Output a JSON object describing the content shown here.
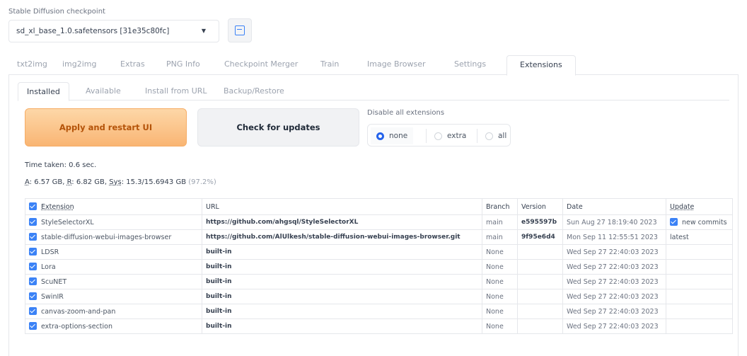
{
  "checkpoint": {
    "label": "Stable Diffusion checkpoint",
    "value": "sd_xl_base_1.0.safetensors [31e35c80fc]"
  },
  "main_tabs": [
    "txt2img",
    "img2img",
    "Extras",
    "PNG Info",
    "Checkpoint Merger",
    "Train",
    "Image Browser",
    "Settings",
    "Extensions"
  ],
  "sub_tabs": [
    "Installed",
    "Available",
    "Install from URL",
    "Backup/Restore"
  ],
  "buttons": {
    "apply": "Apply and restart UI",
    "check": "Check for updates"
  },
  "disable": {
    "label": "Disable all extensions",
    "options": [
      "none",
      "extra",
      "all"
    ],
    "selected": "none"
  },
  "time_taken": "Time taken: 0.6 sec.",
  "memory": {
    "a_label": "A",
    "a_value": ": 6.57 GB, ",
    "r_label": "R",
    "r_value": ": 6.82 GB, ",
    "sys_label": "Sys",
    "sys_value": ": 15.3/15.6943 GB ",
    "pct": "(97.2%)"
  },
  "table": {
    "headers": [
      "Extension",
      "URL",
      "Branch",
      "Version",
      "Date",
      "Update"
    ],
    "rows": [
      {
        "name": "StyleSelectorXL",
        "url": "https://github.com/ahgsql/StyleSelectorXL",
        "branch": "main",
        "version": "e595597b",
        "date": "Sun Aug 27 18:19:40 2023",
        "update": "new commits"
      },
      {
        "name": "stable-diffusion-webui-images-browser",
        "url": "https://github.com/AlUlkesh/stable-diffusion-webui-images-browser.git",
        "branch": "main",
        "version": "9f95e6d4",
        "date": "Mon Sep 11 12:55:51 2023",
        "update": "latest"
      },
      {
        "name": "LDSR",
        "url": "built-in",
        "branch": "None",
        "version": "",
        "date": "Wed Sep 27 22:40:03 2023",
        "update": ""
      },
      {
        "name": "Lora",
        "url": "built-in",
        "branch": "None",
        "version": "",
        "date": "Wed Sep 27 22:40:03 2023",
        "update": ""
      },
      {
        "name": "ScuNET",
        "url": "built-in",
        "branch": "None",
        "version": "",
        "date": "Wed Sep 27 22:40:03 2023",
        "update": ""
      },
      {
        "name": "SwinIR",
        "url": "built-in",
        "branch": "None",
        "version": "",
        "date": "Wed Sep 27 22:40:03 2023",
        "update": ""
      },
      {
        "name": "canvas-zoom-and-pan",
        "url": "built-in",
        "branch": "None",
        "version": "",
        "date": "Wed Sep 27 22:40:03 2023",
        "update": ""
      },
      {
        "name": "extra-options-section",
        "url": "built-in",
        "branch": "None",
        "version": "",
        "date": "Wed Sep 27 22:40:03 2023",
        "update": ""
      }
    ]
  },
  "colors": {
    "accent": "#3b82f6",
    "apply_bg": "#f9b573",
    "apply_text": "#b45309"
  }
}
